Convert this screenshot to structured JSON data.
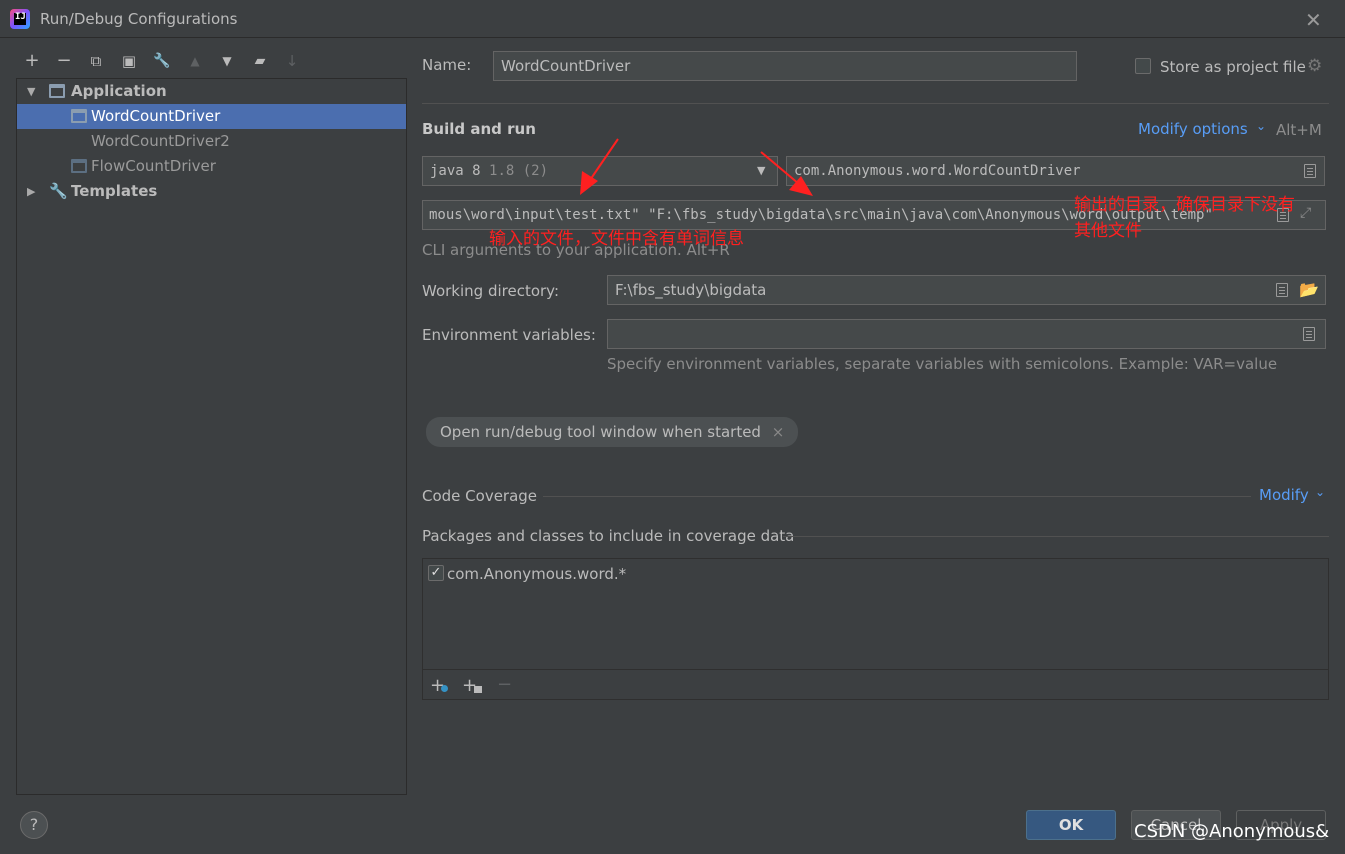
{
  "window": {
    "title": "Run/Debug Configurations"
  },
  "toolbar": {
    "add": "+",
    "remove": "−",
    "copy": "⧉",
    "save": "▣",
    "edit": "🔧",
    "up": "▲",
    "down": "▼",
    "folder": "▰",
    "sort": "↓"
  },
  "tree": {
    "application": "Application",
    "items": [
      "WordCountDriver",
      "WordCountDriver2",
      "FlowCountDriver"
    ],
    "templates": "Templates"
  },
  "form": {
    "name_label": "Name:",
    "name_value": "WordCountDriver",
    "store_label": "Store as project file",
    "build_run": "Build and run",
    "modify_options": "Modify options",
    "modify_shortcut": "Alt+M",
    "jdk_value": "java 8",
    "jdk_version": "1.8 (2)",
    "main_class": "com.Anonymous.word.WordCountDriver",
    "program_args": "mous\\word\\input\\test.txt\" \"F:\\fbs_study\\bigdata\\src\\main\\java\\com\\Anonymous\\word\\output\\temp\"",
    "args_hint": "CLI arguments to your application. Alt+R",
    "working_dir_label": "Working directory:",
    "working_dir_value": "F:\\fbs_study\\bigdata",
    "env_label": "Environment variables:",
    "env_value": "",
    "env_hint": "Specify environment variables, separate variables with semicolons. Example: VAR=value",
    "chip_label": "Open run/debug tool window when started",
    "chip_close": "×",
    "coverage_title": "Code Coverage",
    "coverage_modify": "Modify",
    "packages_label": "Packages and classes to include in coverage data",
    "package_item": "com.Anonymous.word.*"
  },
  "annotations": {
    "input_note": "输入的文件，文件中含有单词信息",
    "output_note_line1": "输出的目录，确保目录下没有",
    "output_note_line2": "其他文件"
  },
  "buttons": {
    "ok": "OK",
    "cancel": "Cancel",
    "apply": "Apply",
    "help": "?"
  },
  "watermark": "CSDN @Anonymous&",
  "colors": {
    "accent": "#589df6",
    "selection": "#4b6eaf",
    "annotation": "#ff2020"
  }
}
